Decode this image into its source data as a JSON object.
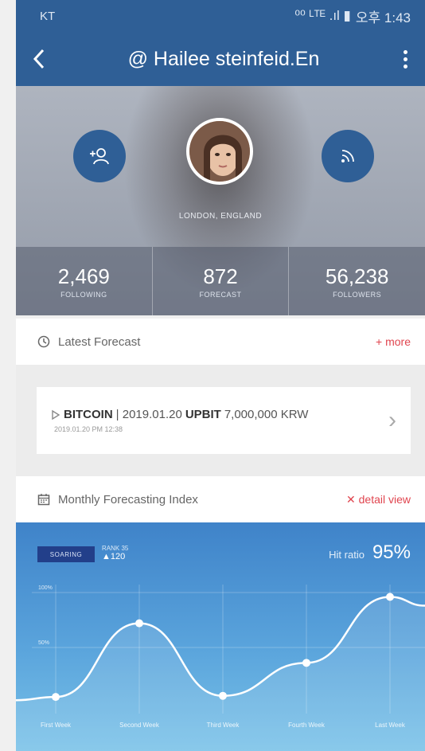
{
  "status_bar": {
    "carrier": "KT",
    "indicators": "⁰⁰ ᴸᵀᴱ .ıl ▮",
    "time": "오후 1:43"
  },
  "app_bar": {
    "back_icon": "chevron-left-icon",
    "title": "@ Hailee steinfeid.En",
    "menu_icon": "kebab-icon"
  },
  "profile": {
    "location": "LONDON, ENGLAND",
    "follow_icon": "add-user-icon",
    "feed_icon": "rss-icon",
    "stats": [
      {
        "value": "2,469",
        "label": "FOLLOWING"
      },
      {
        "value": "872",
        "label": "FORECAST"
      },
      {
        "value": "56,238",
        "label": "FOLLOWERS"
      }
    ]
  },
  "latest_forecast": {
    "title": "Latest Forecast",
    "more_label": "+ more",
    "card": {
      "coin": "BITCOIN",
      "date": "| 2019.01.20",
      "exchange": "UPBIT",
      "price": "7,000,000 KRW",
      "timestamp": "2019.01.20 PM 12:38"
    }
  },
  "monthly_index": {
    "title": "Monthly Forecasting Index",
    "detail_label": "✕ detail view",
    "badge": "SOARING",
    "rank_label": "RANK 35",
    "rank_change": "▲120",
    "hit_ratio_label": "Hit ratio",
    "hit_ratio_value": "95%"
  },
  "chart_data": {
    "type": "line",
    "categories": [
      "First Week",
      "Second Week",
      "Third Week",
      "Fourth Week",
      "Last Week"
    ],
    "y_tick_labels": [
      "100%",
      "50%"
    ],
    "ylim": [
      0,
      100
    ],
    "series": [
      {
        "values": [
          5,
          72,
          6,
          36,
          96
        ]
      }
    ],
    "grid": true
  },
  "colors": {
    "primary": "#2f5f96",
    "accent_red": "#e0454f",
    "chart_top": "#3f83c9",
    "chart_bottom": "#79c2e8"
  }
}
